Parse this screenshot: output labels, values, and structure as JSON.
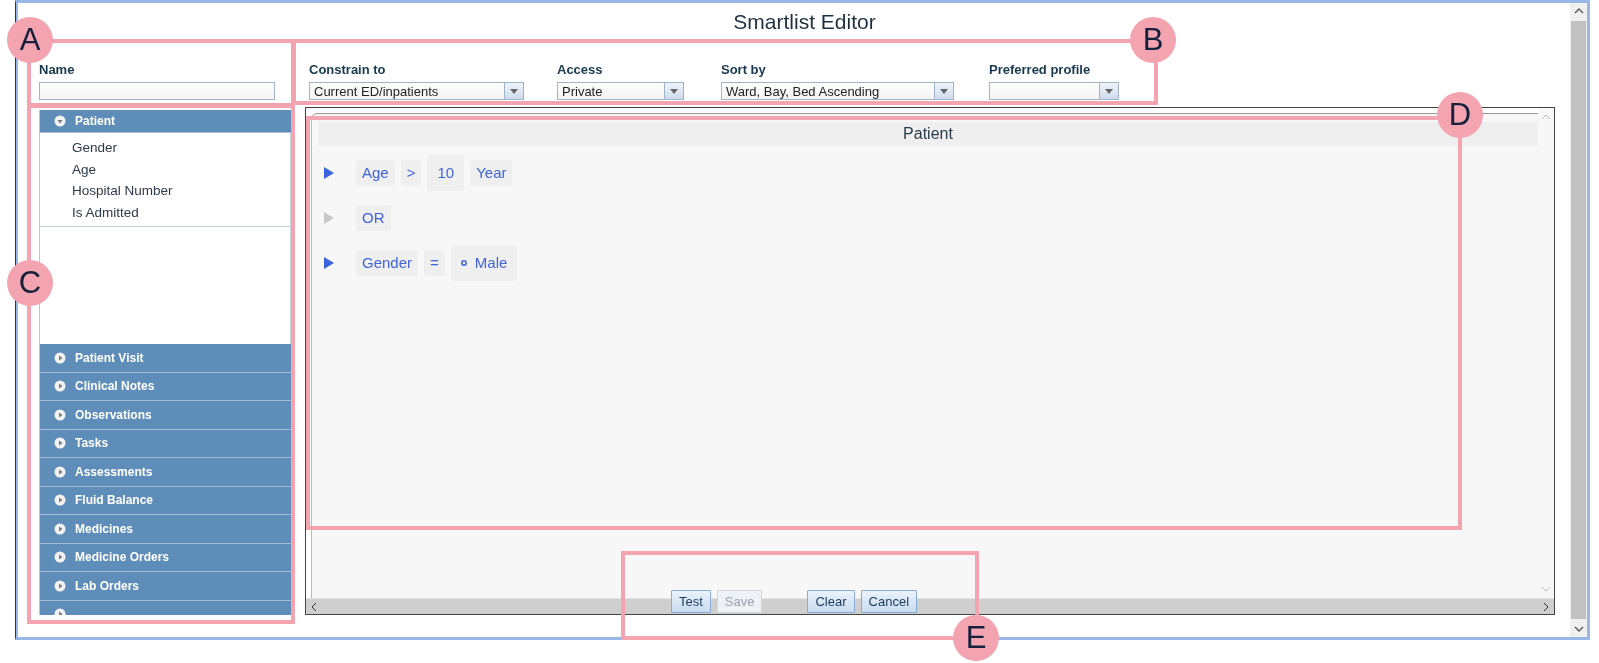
{
  "window": {
    "title": "Smartlist Editor"
  },
  "fields": [
    {
      "kind": "text",
      "label": "Name"
    },
    {
      "kind": "select",
      "label": "Constrain to",
      "value": "Current ED/inpatients"
    },
    {
      "kind": "select",
      "label": "Access",
      "value": "Private"
    },
    {
      "kind": "select",
      "label": "Sort by",
      "value": "Ward, Bay, Bed Ascending"
    },
    {
      "kind": "select",
      "label": "Preferred profile"
    }
  ],
  "sidebar": {
    "groups": [
      {
        "label": "Patient",
        "expanded": true,
        "children": [
          {
            "label": "Gender"
          },
          {
            "label": "Age"
          },
          {
            "label": "Hospital Number"
          },
          {
            "label": "Is Admitted"
          }
        ]
      },
      {
        "label": "Patient Visit",
        "expanded": false
      },
      {
        "label": "Clinical Notes",
        "expanded": false
      },
      {
        "label": "Observations",
        "expanded": false
      },
      {
        "label": "Tasks",
        "expanded": false
      },
      {
        "label": "Assessments",
        "expanded": false
      },
      {
        "label": "Fluid Balance",
        "expanded": false
      },
      {
        "label": "Medicines",
        "expanded": false
      },
      {
        "label": "Medicine Orders",
        "expanded": false
      },
      {
        "label": "Lab Orders",
        "expanded": false
      },
      {
        "expanded": false
      }
    ]
  },
  "editor": {
    "title": "Patient",
    "rows": [
      {
        "enabled": true,
        "tokens": [
          {
            "kind": "field",
            "text": "Age"
          },
          {
            "kind": "operator",
            "text": ">"
          },
          {
            "kind": "value",
            "text": "10"
          },
          {
            "kind": "unit",
            "text": "Year"
          }
        ]
      },
      {
        "enabled": false,
        "tokens": [
          {
            "kind": "connector",
            "text": "OR"
          }
        ]
      },
      {
        "enabled": true,
        "tokens": [
          {
            "kind": "field",
            "text": "Gender"
          },
          {
            "kind": "operator",
            "text": "="
          },
          {
            "kind": "option",
            "text": "Male"
          }
        ]
      }
    ]
  },
  "button_groups": [
    [
      {
        "label": "Test",
        "disabled": false
      },
      {
        "label": "Save",
        "disabled": true
      }
    ],
    [
      {
        "label": "Clear",
        "disabled": false
      },
      {
        "label": "Cancel",
        "disabled": false
      }
    ]
  ],
  "callouts": [
    {
      "label": "A"
    },
    {
      "label": "B"
    },
    {
      "label": "C"
    },
    {
      "label": "D"
    },
    {
      "label": "E"
    }
  ]
}
